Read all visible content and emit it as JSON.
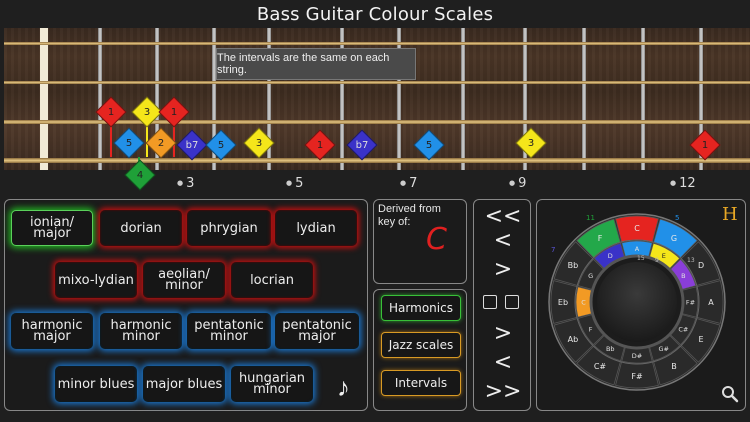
{
  "app": {
    "title": "Bass Guitar Colour Scales"
  },
  "fretboard": {
    "tooltip": "The intervals are the same on each string.",
    "fret_markers": [
      "3",
      "5",
      "7",
      "9",
      "12"
    ],
    "notes": [
      {
        "label": "1",
        "color": "#e52420"
      },
      {
        "label": "3",
        "color": "#f5e61a"
      },
      {
        "label": "1",
        "color": "#e52420"
      },
      {
        "label": "5",
        "color": "#2190e8"
      },
      {
        "label": "2",
        "color": "#f29a24"
      },
      {
        "label": "b7",
        "color": "#3a32c8"
      },
      {
        "label": "5",
        "color": "#2190e8"
      },
      {
        "label": "3",
        "color": "#f5e61a"
      },
      {
        "label": "1",
        "color": "#e52420"
      },
      {
        "label": "b7",
        "color": "#3a32c8"
      },
      {
        "label": "5",
        "color": "#2190e8"
      },
      {
        "label": "3",
        "color": "#f5e61a"
      },
      {
        "label": "1",
        "color": "#e52420"
      },
      {
        "label": "4",
        "color": "#1fa038"
      }
    ]
  },
  "scales": {
    "ionian": "ionian/ major",
    "dorian": "dorian",
    "phrygian": "phrygian",
    "lydian": "lydian",
    "mixolydian": "mixo-lydian",
    "aeolian": "aeolian/ minor",
    "locrian": "locrian",
    "harmonic_major": "harmonic major",
    "harmonic_minor": "harmonic minor",
    "pentatonic_minor": "pentatonic minor",
    "pentatonic_major": "pentatonic major",
    "minor_blues": "minor blues",
    "major_blues": "major blues",
    "hungarian_minor": "hungarian minor",
    "music_icon": "♪"
  },
  "derived": {
    "label": "Derived from key of:",
    "key": "C"
  },
  "modes": {
    "harmonics": "Harmonics",
    "jazz": "Jazz scales",
    "intervals": "Intervals"
  },
  "nav": {
    "first": "<<",
    "prev": "<",
    "next_top": ">",
    "next_bottom": ">",
    "prev_bottom": "<",
    "last": ">>"
  },
  "wheel": {
    "letter": "H",
    "outer_notes": [
      "C",
      "G",
      "D",
      "A",
      "E",
      "B",
      "F#",
      "C#",
      "Ab",
      "Eb",
      "Bb",
      "F"
    ],
    "inner_notes": [
      "A",
      "E",
      "B",
      "F#",
      "C#",
      "G#",
      "D#",
      "Bb",
      "F",
      "C",
      "G",
      "D"
    ],
    "degree_labels": [
      "11",
      "7",
      "5",
      "15",
      "9",
      "13"
    ],
    "colors": {
      "red": "#e52420",
      "blue": "#2190e8",
      "yellow": "#f5e61a",
      "purple": "#8a3ed8",
      "green": "#23a84a",
      "orange": "#f29a24",
      "navy": "#3a32c8"
    }
  }
}
